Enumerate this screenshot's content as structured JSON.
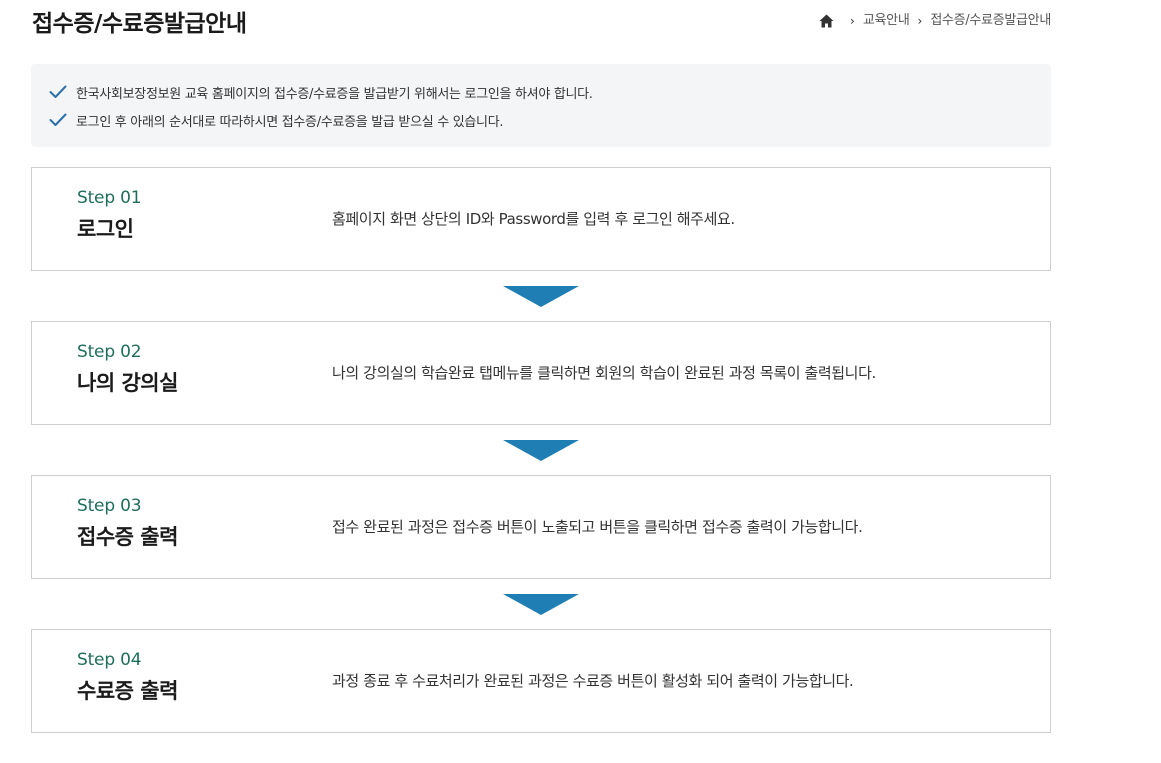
{
  "header": {
    "title": "접수증/수료증발급안내",
    "breadcrumb": [
      "교육안내",
      "접수증/수료증발급안내"
    ]
  },
  "notice": [
    "한국사회보장정보원 교육 홈페이지의 접수증/수료증을 발급받기 위해서는 로그인을 하셔야 합니다.",
    "로그인 후 아래의 순서대로 따라하시면 접수증/수료증을 발급 받으실 수 있습니다."
  ],
  "steps": [
    {
      "num": "Step 01",
      "name": "로그인",
      "desc": "홈페이지 화면 상단의 ID와 Password를 입력 후 로그인 해주세요."
    },
    {
      "num": "Step 02",
      "name": "나의 강의실",
      "desc": "나의 강의실의 학습완료 탭메뉴를 클릭하면 회원의 학습이 완료된 과정 목록이 출력됩니다."
    },
    {
      "num": "Step 03",
      "name": "접수증 출력",
      "desc": "접수 완료된 과정은 접수증 버튼이 노출되고 버튼을 클릭하면 접수증 출력이 가능합니다."
    },
    {
      "num": "Step 04",
      "name": "수료증 출력",
      "desc": "과정 종료 후 수료처리가 완료된 과정은 수료증 버튼이 활성화 되어 출력이 가능합니다."
    }
  ],
  "colors": {
    "accent": "#1f7fb5",
    "step_number": "#1f6e5c",
    "check": "#2b6fa8"
  },
  "icons": {
    "home": "home-icon",
    "breadcrumb_separator": "chevron-right-icon",
    "check": "check-icon",
    "arrow": "arrow-down-icon"
  }
}
